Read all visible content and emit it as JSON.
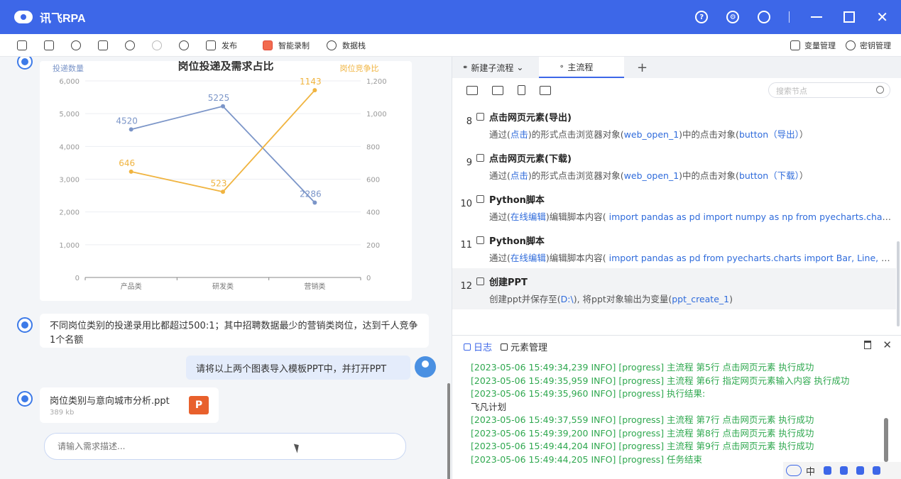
{
  "app": {
    "title": "讯飞RPA"
  },
  "toolbar": {
    "publish": "发布",
    "smart_record": "智能录制",
    "data_stack": "数据栈",
    "var_manage": "变量管理",
    "key_manage": "密钥管理"
  },
  "chart_data": {
    "type": "line",
    "title": "岗位投递及需求占比",
    "ylabel_left": "投递数量",
    "ylabel_right": "岗位竞争比",
    "categories": [
      "产品类",
      "研发类",
      "营销类"
    ],
    "yleft_ticks": [
      "0",
      "1,000",
      "2,000",
      "3,000",
      "4,000",
      "5,000",
      "6,000"
    ],
    "yright_ticks": [
      "0",
      "200",
      "400",
      "600",
      "800",
      "1,000",
      "1,200"
    ],
    "ylim_left": [
      0,
      6000
    ],
    "ylim_right": [
      0,
      1200
    ],
    "series": [
      {
        "axis": "left",
        "values": [
          4520,
          5225,
          2286
        ],
        "color": "#7b95c8"
      },
      {
        "axis": "right",
        "values": [
          646,
          523,
          1143
        ],
        "color": "#f0b440"
      }
    ]
  },
  "chat": {
    "msg1": "不同岗位类别的投递录用比都超过500:1；其中招聘数据最少的营销类岗位，达到千人竞争1个名额",
    "user_msg": "请将以上两个图表导入模板PPT中，并打开PPT",
    "file_name": "岗位类别与意向城市分析.ppt",
    "file_size": "389 kb",
    "file_icon": "P",
    "input_placeholder": "请输入需求描述..."
  },
  "tabs": {
    "sub_flow": "新建子流程",
    "main_flow": "主流程",
    "add": "+"
  },
  "search": {
    "placeholder": "搜索节点"
  },
  "steps": [
    {
      "no": "8",
      "title": "点击网页元素(导出)",
      "desc": [
        [
          "p",
          "通过("
        ],
        [
          "k",
          "点击"
        ],
        [
          "p",
          ")的形式点击浏览器对象("
        ],
        [
          "k",
          "web_open_1"
        ],
        [
          "p",
          ")中的点击对象("
        ],
        [
          "k",
          "button（导出）"
        ],
        [
          "p",
          "）"
        ]
      ]
    },
    {
      "no": "9",
      "title": "点击网页元素(下载)",
      "desc": [
        [
          "p",
          "通过("
        ],
        [
          "k",
          "点击"
        ],
        [
          "p",
          ")的形式点击浏览器对象("
        ],
        [
          "k",
          "web_open_1"
        ],
        [
          "p",
          ")中的点击对象("
        ],
        [
          "k",
          "button（下载）"
        ],
        [
          "p",
          "）"
        ]
      ]
    },
    {
      "no": "10",
      "title": "Python脚本",
      "desc": [
        [
          "p",
          "通过("
        ],
        [
          "k",
          "在线编辑"
        ],
        [
          "p",
          ")编辑脚本内容( "
        ],
        [
          "k",
          "import pandas as pd import numpy as np from pyecharts.charts import Bar, Line"
        ]
      ]
    },
    {
      "no": "11",
      "title": "Python脚本",
      "desc": [
        [
          "p",
          "通过("
        ],
        [
          "k",
          "在线编辑"
        ],
        [
          "p",
          ")编辑脚本内容( "
        ],
        [
          "k",
          "import pandas as pd from pyecharts.charts import Bar, Line, Pie"
        ]
      ]
    },
    {
      "no": "12",
      "title": "创建PPT",
      "desc": [
        [
          "p",
          "创建ppt并保存至("
        ],
        [
          "k",
          "D:\\"
        ],
        [
          "p",
          "), 将ppt对象输出为变量("
        ],
        [
          "k",
          "ppt_create_1"
        ],
        [
          "p",
          ")"
        ]
      ]
    }
  ],
  "log": {
    "tab_log": "日志",
    "tab_elements": "元素管理",
    "lines": [
      {
        "t": "[2023-05-06 15:49:34,239 INFO] [progress] 主流程 第5行 点击网页元素 执行成功",
        "c": "ok"
      },
      {
        "t": "[2023-05-06 15:49:35,959 INFO] [progress] 主流程 第6行 指定网页元素输入内容 执行成功",
        "c": "ok"
      },
      {
        "t": "[2023-05-06 15:49:35,960 INFO] [progress] 执行结果:",
        "c": "ok"
      },
      {
        "t": "飞凡计划",
        "c": "plain"
      },
      {
        "t": "[2023-05-06 15:49:37,559 INFO] [progress] 主流程 第7行 点击网页元素 执行成功",
        "c": "ok"
      },
      {
        "t": "[2023-05-06 15:49:39,200 INFO] [progress] 主流程 第8行 点击网页元素 执行成功",
        "c": "ok"
      },
      {
        "t": "[2023-05-06 15:49:44,204 INFO] [progress] 主流程 第9行 点击网页元素 执行成功",
        "c": "ok"
      },
      {
        "t": "[2023-05-06 15:49:44,205 INFO] [progress] 任务结束",
        "c": "ok"
      }
    ]
  },
  "tray": {
    "lang": "中"
  }
}
